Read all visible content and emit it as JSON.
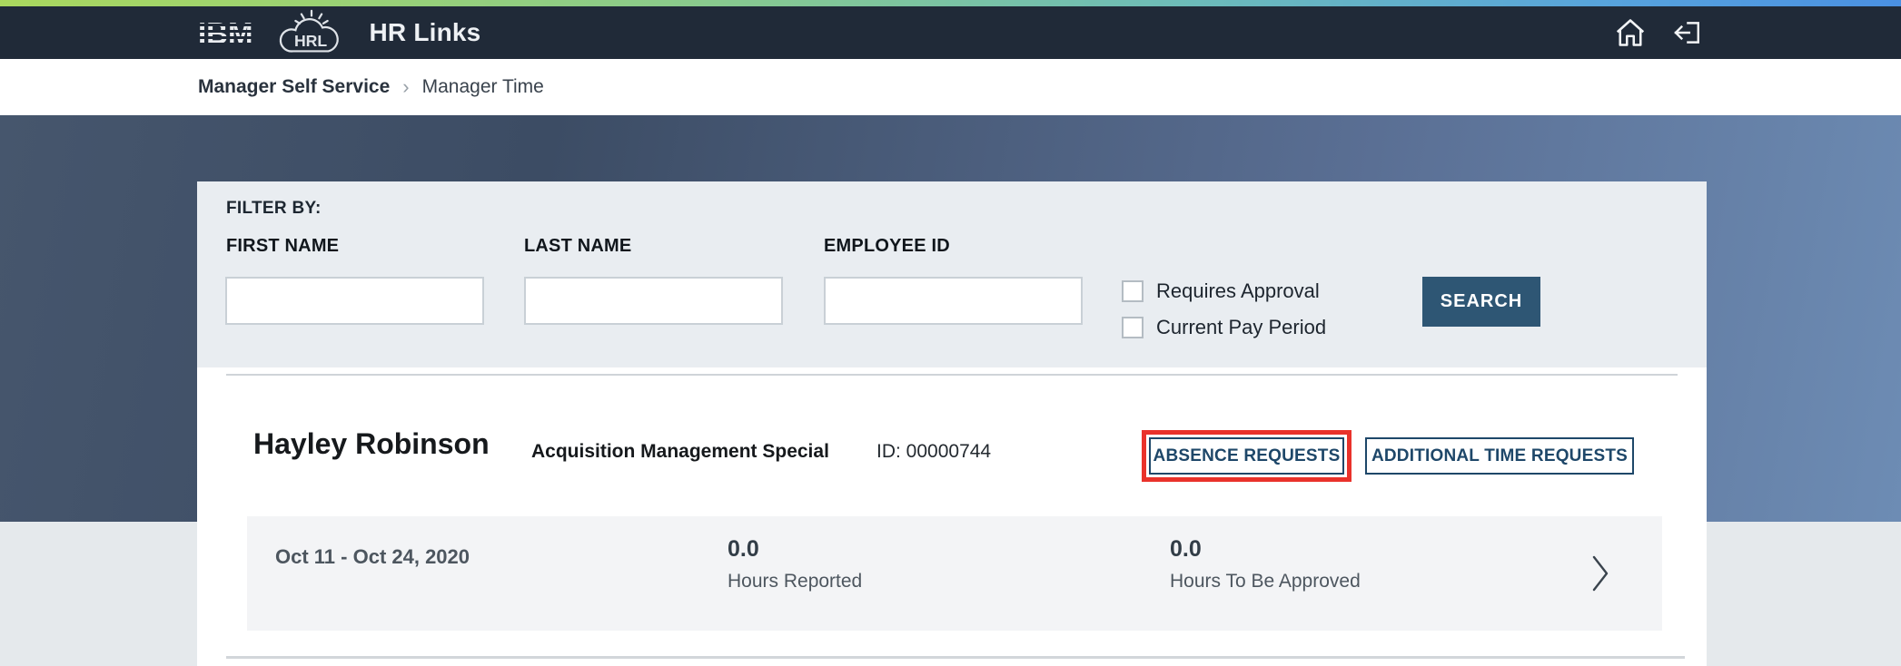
{
  "header": {
    "logo_text": "IBM",
    "logo_badge": "HRL",
    "brand": "HR Links"
  },
  "breadcrumb": {
    "section": "Manager Self Service",
    "separator": "›",
    "page": "Manager Time"
  },
  "filter": {
    "title": "FILTER BY:",
    "fields": [
      {
        "label": "FIRST NAME",
        "value": "",
        "placeholder": ""
      },
      {
        "label": "LAST NAME",
        "value": "",
        "placeholder": ""
      },
      {
        "label": "EMPLOYEE ID",
        "value": "",
        "placeholder": ""
      }
    ],
    "checkboxes": [
      {
        "label": "Requires Approval",
        "checked": false
      },
      {
        "label": "Current Pay Period",
        "checked": false
      }
    ],
    "search_label": "SEARCH"
  },
  "employee": {
    "name": "Hayley Robinson",
    "job_title": "Acquisition Management Special",
    "id_text": "ID: 00000744",
    "actions": [
      {
        "label": "ABSENCE REQUESTS",
        "highlighted": true
      },
      {
        "label": "ADDITIONAL TIME REQUESTS",
        "highlighted": false
      }
    ]
  },
  "pay_periods": [
    {
      "range": "Oct 11 - Oct 24, 2020",
      "hours_reported_value": "0.0",
      "hours_reported_label": "Hours Reported",
      "hours_to_approve_value": "0.0",
      "hours_to_approve_label": "Hours To Be Approved"
    }
  ],
  "colors": {
    "header_navy": "#202a38",
    "accent_strip_left": "#aad85e",
    "accent_strip_right": "#4a90e2",
    "hero_left": "#3c4c64",
    "hero_right": "#6d8cb4",
    "search_button": "#2e5674",
    "action_button_border": "#1e4769",
    "highlight_red": "#e9322b",
    "panel_gray": "#e9edf1",
    "row_gray": "#f3f4f6"
  }
}
